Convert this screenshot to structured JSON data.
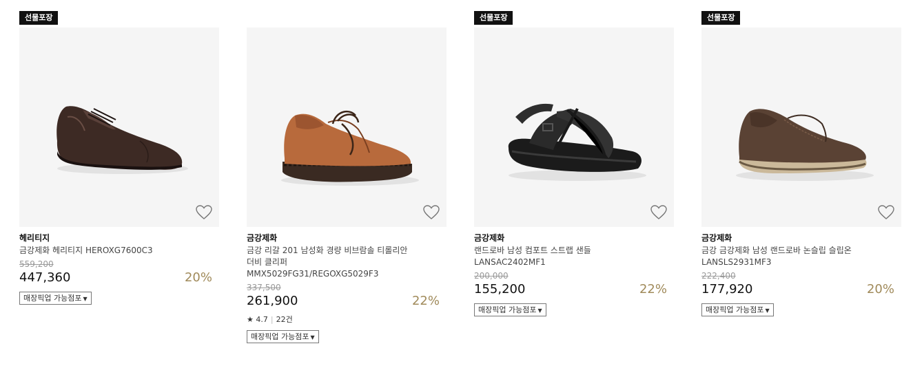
{
  "products": [
    {
      "badge": "선물포장",
      "brand": "헤리티지",
      "name_lines": [
        "금강제화 헤리티지 HEROXG7600C3"
      ],
      "original_price": "559,200",
      "price": "447,360",
      "discount": "20%",
      "pickup_label": "매장픽업 가능점포"
    },
    {
      "badge": "",
      "brand": "금강제화",
      "name_lines": [
        "금강 리갈 201 남성화 경량 비브람솔 티롤리안",
        "더비 클리퍼",
        "MMX5029FG31/REGOXG5029F3"
      ],
      "original_price": "337,500",
      "price": "261,900",
      "discount": "22%",
      "rating": "4.7",
      "reviews": "22건",
      "pickup_label": "매장픽업 가능점포"
    },
    {
      "badge": "선물포장",
      "brand": "금강제화",
      "name_lines": [
        "랜드로바 남성 컴포트 스트랩 샌들",
        "LANSAC2402MF1"
      ],
      "original_price": "200,000",
      "price": "155,200",
      "discount": "22%",
      "pickup_label": "매장픽업 가능점포"
    },
    {
      "badge": "선물포장",
      "brand": "금강제화",
      "name_lines": [
        "금강 금강제화 남성 랜드로바 논슬립 슬립온",
        "LANSLS2931MF3"
      ],
      "original_price": "222,400",
      "price": "177,920",
      "discount": "20%",
      "pickup_label": "매장픽업 가능점포"
    }
  ],
  "icons": {
    "wishlist": "heart-outline-icon",
    "star": "star-icon",
    "dropdown": "caret-down-icon"
  },
  "colors": {
    "discount": "#a08a5a",
    "badge_bg": "#111111",
    "image_bg": "#f5f5f5"
  }
}
